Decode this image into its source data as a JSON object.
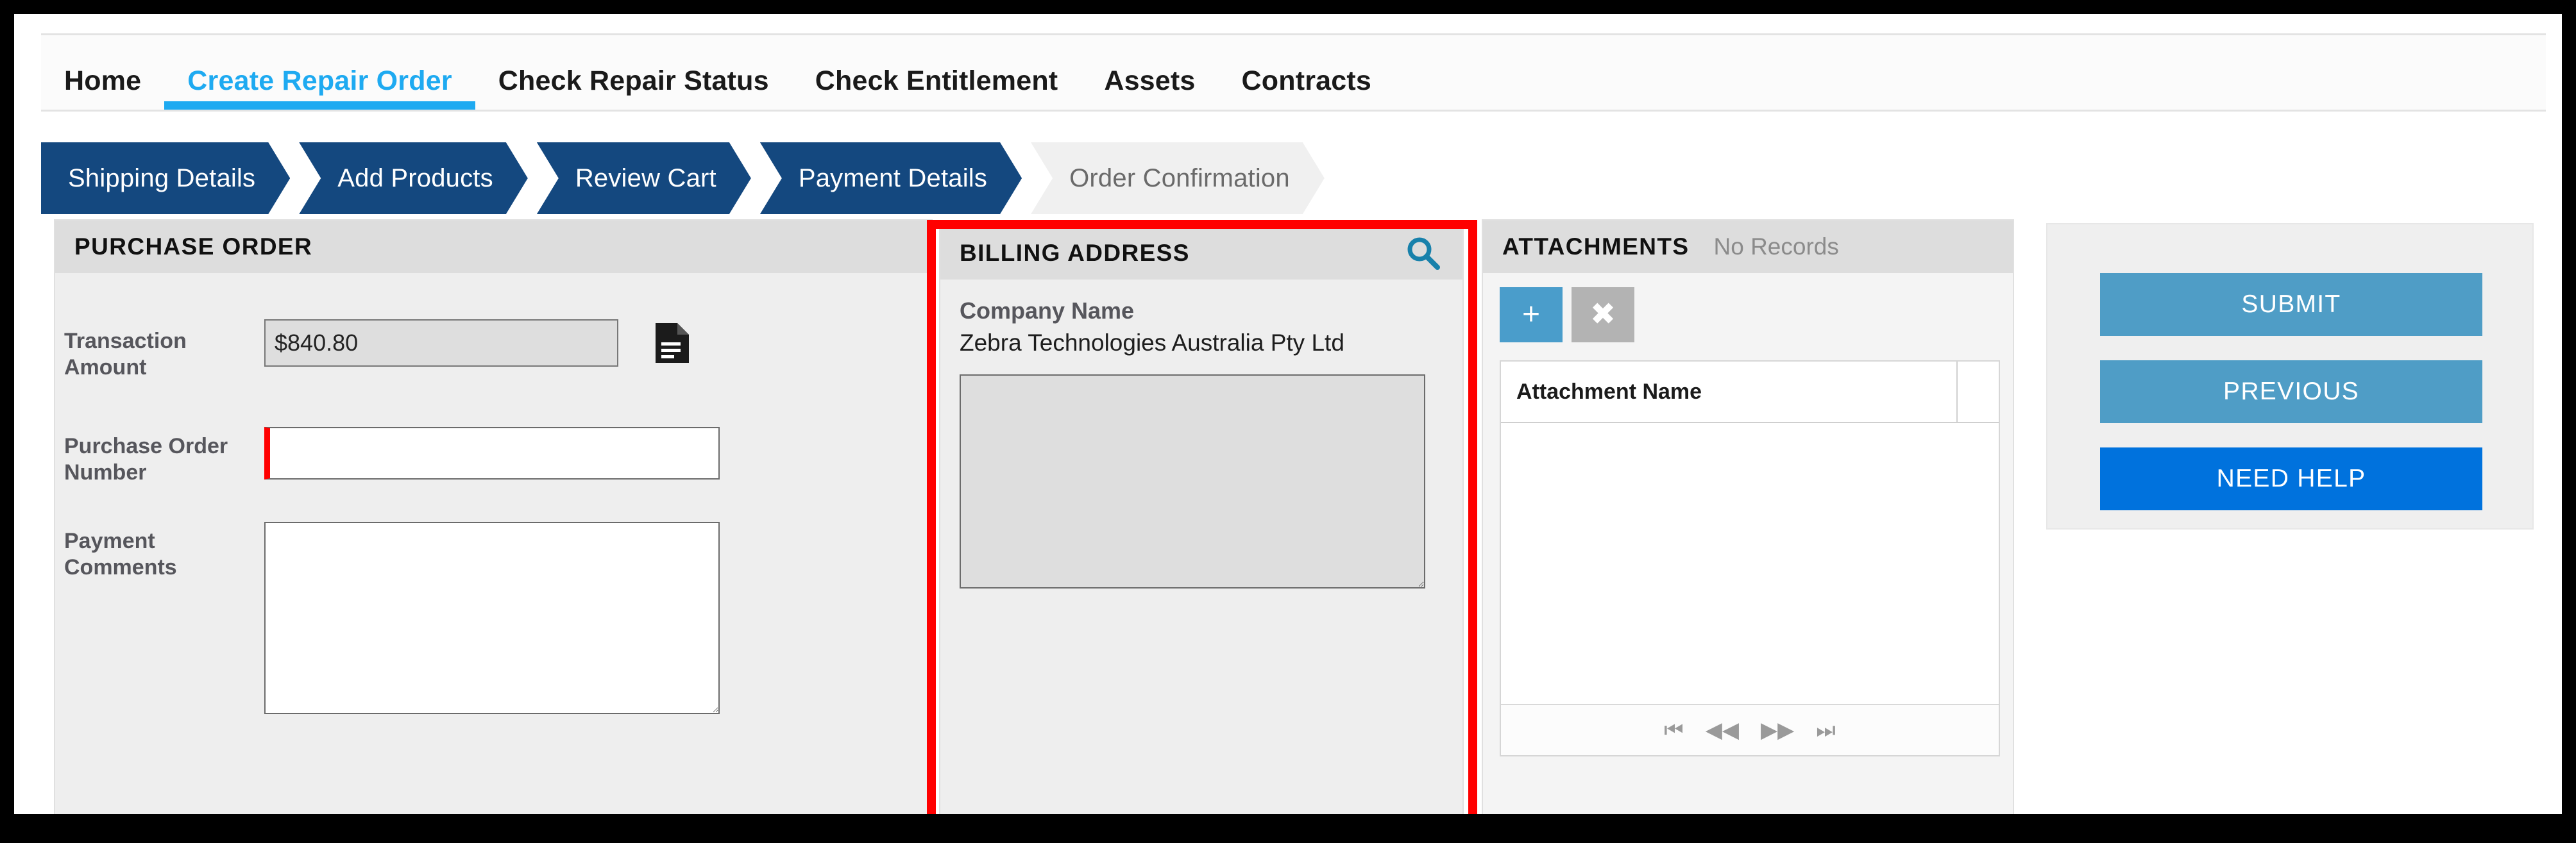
{
  "nav": {
    "tabs": [
      {
        "label": "Home",
        "active": false
      },
      {
        "label": "Create Repair Order",
        "active": true
      },
      {
        "label": "Check Repair Status",
        "active": false
      },
      {
        "label": "Check Entitlement",
        "active": false
      },
      {
        "label": "Assets",
        "active": false
      },
      {
        "label": "Contracts",
        "active": false
      }
    ]
  },
  "wizard": {
    "steps": [
      {
        "label": "Shipping Details",
        "state": "done"
      },
      {
        "label": "Add Products",
        "state": "done"
      },
      {
        "label": "Review Cart",
        "state": "done"
      },
      {
        "label": "Payment Details",
        "state": "current"
      },
      {
        "label": "Order Confirmation",
        "state": "inactive"
      }
    ]
  },
  "purchase_order": {
    "title": "PURCHASE ORDER",
    "transaction_amount_label": "Transaction Amount",
    "transaction_amount_value": "$840.80",
    "document_icon": "document-icon",
    "po_number_label": "Purchase Order Number",
    "po_number_value": "",
    "po_number_placeholder": "",
    "payment_comments_label": "Payment Comments",
    "payment_comments_value": "",
    "payment_comments_placeholder": ""
  },
  "billing_address": {
    "title": "BILLING ADDRESS",
    "search_icon": "search-icon",
    "company_name_label": "Company Name",
    "company_name_value": "Zebra Technologies Australia Pty Ltd",
    "address_textarea_value": ""
  },
  "attachments": {
    "title": "ATTACHMENTS",
    "status": "No Records",
    "add_label": "+",
    "delete_label": "✖",
    "columns": [
      "Attachment Name"
    ],
    "rows": [],
    "pager": {
      "first": "⏮",
      "prev": "◀◀",
      "next": "▶▶",
      "last": "⏭"
    }
  },
  "actions": {
    "submit_label": "SUBMIT",
    "previous_label": "PREVIOUS",
    "need_help_label": "NEED HELP"
  },
  "colors": {
    "accent_blue": "#1eaaf1",
    "step_blue": "#14487f",
    "button_blue": "#4f9dc6",
    "help_blue": "#0072dd",
    "highlight_red": "#ff0000",
    "required_red": "#ff0000"
  },
  "annotation": {
    "highlight_target": "billing-address-panel",
    "highlight_color": "#ff0000"
  }
}
